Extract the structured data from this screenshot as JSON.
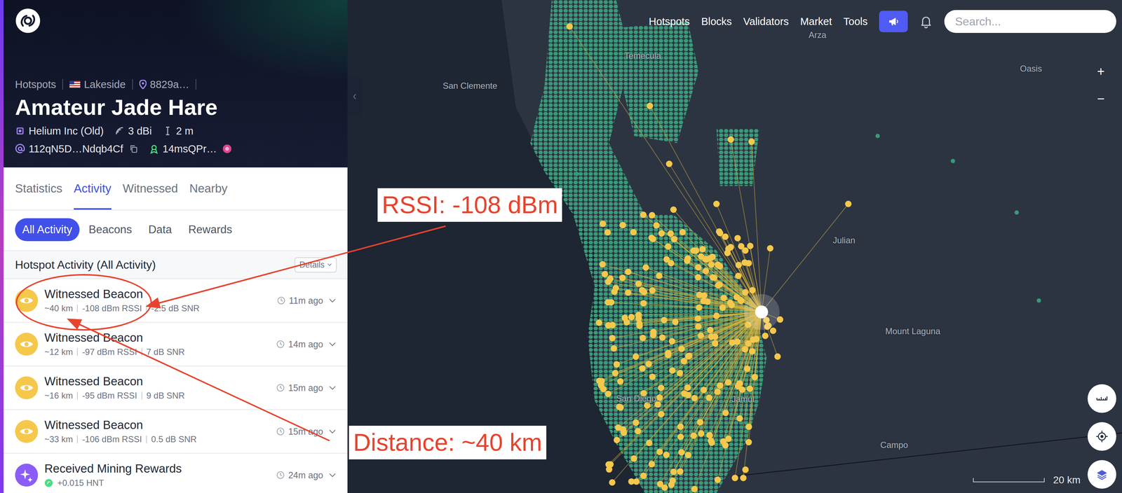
{
  "sidebar": {
    "breadcrumbs": [
      "Hotspots",
      "Lakeside",
      "8829a…"
    ],
    "title": "Amateur Jade Hare",
    "maker": "Helium Inc (Old)",
    "gain": "3 dBi",
    "elevation": "2 m",
    "address": "112qN5D…Ndqb4Cf",
    "owner": "14msQPr…",
    "tabs": [
      {
        "label": "Statistics",
        "selected": false
      },
      {
        "label": "Activity",
        "selected": true
      },
      {
        "label": "Witnessed",
        "selected": false
      },
      {
        "label": "Nearby",
        "selected": false
      }
    ],
    "filters": [
      {
        "label": "All Activity",
        "selected": true
      },
      {
        "label": "Beacons",
        "selected": false
      },
      {
        "label": "Data",
        "selected": false
      },
      {
        "label": "Rewards",
        "selected": false
      }
    ],
    "section_title": "Hotspot Activity (All Activity)",
    "details_button": "Details",
    "activity": [
      {
        "kind": "witness",
        "title": "Witnessed Beacon",
        "distance": "~40 km",
        "rssi": "-108 dBm RSSI",
        "snr": "-2.5 dB SNR",
        "time": "11m ago"
      },
      {
        "kind": "witness",
        "title": "Witnessed Beacon",
        "distance": "~12 km",
        "rssi": "-97 dBm RSSI",
        "snr": "7 dB SNR",
        "time": "14m ago"
      },
      {
        "kind": "witness",
        "title": "Witnessed Beacon",
        "distance": "~16 km",
        "rssi": "-95 dBm RSSI",
        "snr": "9 dB SNR",
        "time": "15m ago"
      },
      {
        "kind": "witness",
        "title": "Witnessed Beacon",
        "distance": "~33 km",
        "rssi": "-106 dBm RSSI",
        "snr": "0.5 dB SNR",
        "time": "15m ago"
      },
      {
        "kind": "reward",
        "title": "Received Mining Rewards",
        "amount": "+0.015 HNT",
        "time": "24m ago"
      }
    ]
  },
  "nav": {
    "items": [
      "Hotspots",
      "Blocks",
      "Validators",
      "Market",
      "Tools"
    ],
    "search_placeholder": "Search..."
  },
  "map": {
    "labels": [
      "San Clemente",
      "Temecula",
      "Arza",
      "Oasis",
      "Julian",
      "Mount Laguna",
      "San Diego",
      "Jamul",
      "Campo"
    ],
    "scale": "20 km",
    "zoom_in": "+",
    "zoom_out": "−"
  },
  "annotations": [
    {
      "text": "RSSI: -108 dBm"
    },
    {
      "text": "Distance: ~40 km"
    }
  ]
}
